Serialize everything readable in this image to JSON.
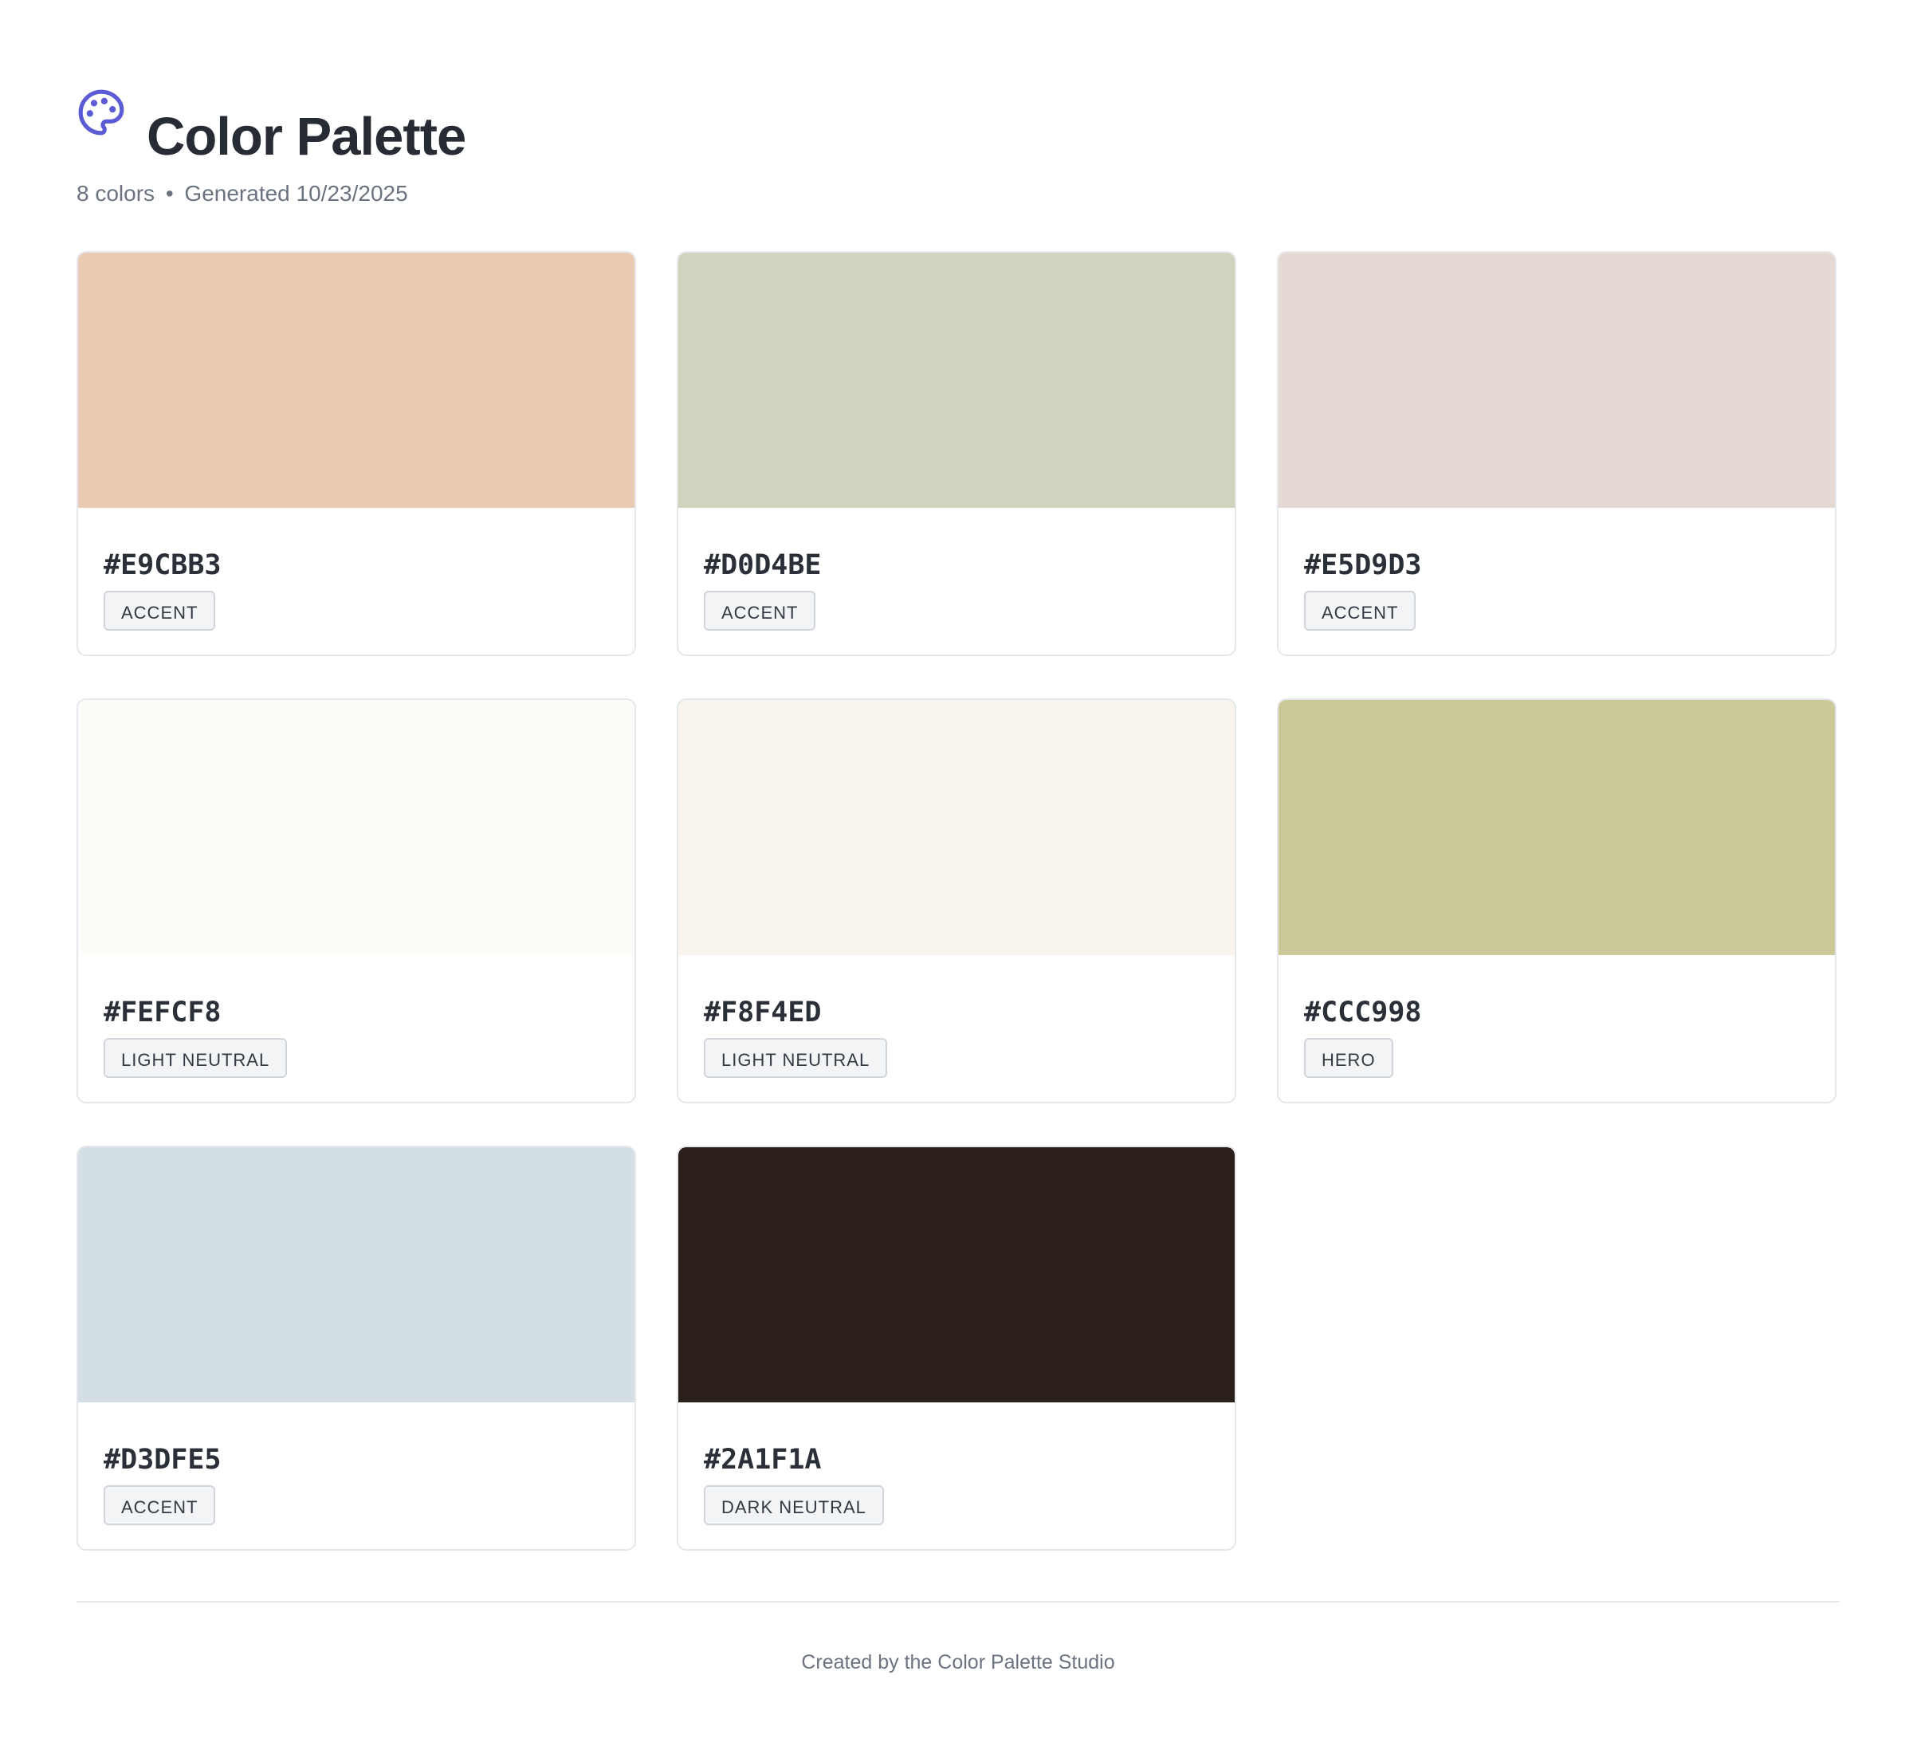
{
  "header": {
    "title": "Color Palette",
    "color_count": "8 colors",
    "separator": "•",
    "generated": "Generated 10/23/2025",
    "icon": "palette-icon",
    "icon_color": "#5b5bd6"
  },
  "palette": [
    {
      "hex": "#E9CBB3",
      "role": "ACCENT",
      "color": "#E9CBB3"
    },
    {
      "hex": "#D0D4BE",
      "role": "ACCENT",
      "color": "#D0D4BE"
    },
    {
      "hex": "#E5D9D3",
      "role": "ACCENT",
      "color": "#E5D9D3"
    },
    {
      "hex": "#FEFCF8",
      "role": "LIGHT NEUTRAL",
      "color": "#FEFCF8"
    },
    {
      "hex": "#F8F4ED",
      "role": "LIGHT NEUTRAL",
      "color": "#F8F4ED"
    },
    {
      "hex": "#CCC998",
      "role": "HERO",
      "color": "#CCC998"
    },
    {
      "hex": "#D3DFE5",
      "role": "ACCENT",
      "color": "#D3DFE5"
    },
    {
      "hex": "#2A1F1A",
      "role": "DARK NEUTRAL",
      "color": "#2A1F1A"
    }
  ],
  "footer": {
    "text": "Created by the Color Palette Studio"
  }
}
